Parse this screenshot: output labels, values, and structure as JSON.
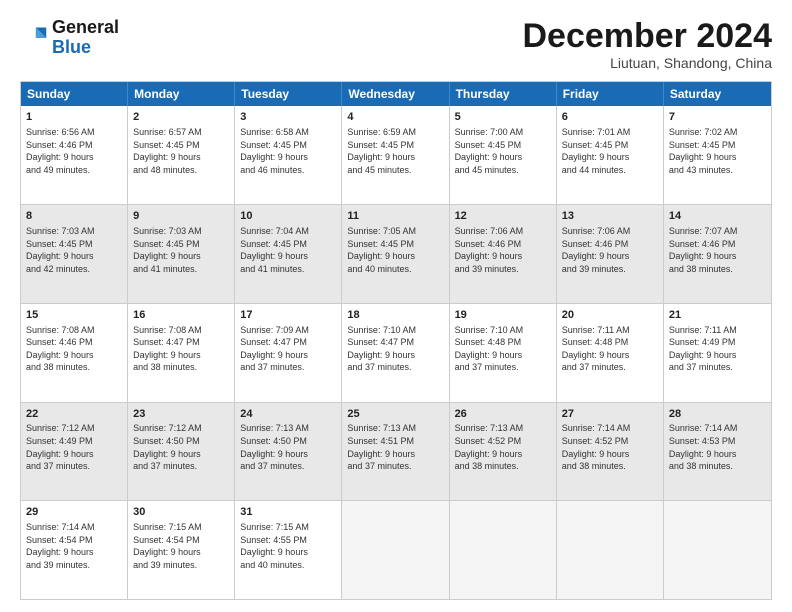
{
  "header": {
    "logo_line1": "General",
    "logo_line2": "Blue",
    "title": "December 2024",
    "subtitle": "Liutuan, Shandong, China"
  },
  "calendar": {
    "days_of_week": [
      "Sunday",
      "Monday",
      "Tuesday",
      "Wednesday",
      "Thursday",
      "Friday",
      "Saturday"
    ],
    "weeks": [
      [
        {
          "day": "1",
          "lines": [
            "Sunrise: 6:56 AM",
            "Sunset: 4:46 PM",
            "Daylight: 9 hours",
            "and 49 minutes."
          ],
          "shaded": false,
          "empty": false
        },
        {
          "day": "2",
          "lines": [
            "Sunrise: 6:57 AM",
            "Sunset: 4:45 PM",
            "Daylight: 9 hours",
            "and 48 minutes."
          ],
          "shaded": false,
          "empty": false
        },
        {
          "day": "3",
          "lines": [
            "Sunrise: 6:58 AM",
            "Sunset: 4:45 PM",
            "Daylight: 9 hours",
            "and 46 minutes."
          ],
          "shaded": false,
          "empty": false
        },
        {
          "day": "4",
          "lines": [
            "Sunrise: 6:59 AM",
            "Sunset: 4:45 PM",
            "Daylight: 9 hours",
            "and 45 minutes."
          ],
          "shaded": false,
          "empty": false
        },
        {
          "day": "5",
          "lines": [
            "Sunrise: 7:00 AM",
            "Sunset: 4:45 PM",
            "Daylight: 9 hours",
            "and 45 minutes."
          ],
          "shaded": false,
          "empty": false
        },
        {
          "day": "6",
          "lines": [
            "Sunrise: 7:01 AM",
            "Sunset: 4:45 PM",
            "Daylight: 9 hours",
            "and 44 minutes."
          ],
          "shaded": false,
          "empty": false
        },
        {
          "day": "7",
          "lines": [
            "Sunrise: 7:02 AM",
            "Sunset: 4:45 PM",
            "Daylight: 9 hours",
            "and 43 minutes."
          ],
          "shaded": false,
          "empty": false
        }
      ],
      [
        {
          "day": "8",
          "lines": [
            "Sunrise: 7:03 AM",
            "Sunset: 4:45 PM",
            "Daylight: 9 hours",
            "and 42 minutes."
          ],
          "shaded": true,
          "empty": false
        },
        {
          "day": "9",
          "lines": [
            "Sunrise: 7:03 AM",
            "Sunset: 4:45 PM",
            "Daylight: 9 hours",
            "and 41 minutes."
          ],
          "shaded": true,
          "empty": false
        },
        {
          "day": "10",
          "lines": [
            "Sunrise: 7:04 AM",
            "Sunset: 4:45 PM",
            "Daylight: 9 hours",
            "and 41 minutes."
          ],
          "shaded": true,
          "empty": false
        },
        {
          "day": "11",
          "lines": [
            "Sunrise: 7:05 AM",
            "Sunset: 4:45 PM",
            "Daylight: 9 hours",
            "and 40 minutes."
          ],
          "shaded": true,
          "empty": false
        },
        {
          "day": "12",
          "lines": [
            "Sunrise: 7:06 AM",
            "Sunset: 4:46 PM",
            "Daylight: 9 hours",
            "and 39 minutes."
          ],
          "shaded": true,
          "empty": false
        },
        {
          "day": "13",
          "lines": [
            "Sunrise: 7:06 AM",
            "Sunset: 4:46 PM",
            "Daylight: 9 hours",
            "and 39 minutes."
          ],
          "shaded": true,
          "empty": false
        },
        {
          "day": "14",
          "lines": [
            "Sunrise: 7:07 AM",
            "Sunset: 4:46 PM",
            "Daylight: 9 hours",
            "and 38 minutes."
          ],
          "shaded": true,
          "empty": false
        }
      ],
      [
        {
          "day": "15",
          "lines": [
            "Sunrise: 7:08 AM",
            "Sunset: 4:46 PM",
            "Daylight: 9 hours",
            "and 38 minutes."
          ],
          "shaded": false,
          "empty": false
        },
        {
          "day": "16",
          "lines": [
            "Sunrise: 7:08 AM",
            "Sunset: 4:47 PM",
            "Daylight: 9 hours",
            "and 38 minutes."
          ],
          "shaded": false,
          "empty": false
        },
        {
          "day": "17",
          "lines": [
            "Sunrise: 7:09 AM",
            "Sunset: 4:47 PM",
            "Daylight: 9 hours",
            "and 37 minutes."
          ],
          "shaded": false,
          "empty": false
        },
        {
          "day": "18",
          "lines": [
            "Sunrise: 7:10 AM",
            "Sunset: 4:47 PM",
            "Daylight: 9 hours",
            "and 37 minutes."
          ],
          "shaded": false,
          "empty": false
        },
        {
          "day": "19",
          "lines": [
            "Sunrise: 7:10 AM",
            "Sunset: 4:48 PM",
            "Daylight: 9 hours",
            "and 37 minutes."
          ],
          "shaded": false,
          "empty": false
        },
        {
          "day": "20",
          "lines": [
            "Sunrise: 7:11 AM",
            "Sunset: 4:48 PM",
            "Daylight: 9 hours",
            "and 37 minutes."
          ],
          "shaded": false,
          "empty": false
        },
        {
          "day": "21",
          "lines": [
            "Sunrise: 7:11 AM",
            "Sunset: 4:49 PM",
            "Daylight: 9 hours",
            "and 37 minutes."
          ],
          "shaded": false,
          "empty": false
        }
      ],
      [
        {
          "day": "22",
          "lines": [
            "Sunrise: 7:12 AM",
            "Sunset: 4:49 PM",
            "Daylight: 9 hours",
            "and 37 minutes."
          ],
          "shaded": true,
          "empty": false
        },
        {
          "day": "23",
          "lines": [
            "Sunrise: 7:12 AM",
            "Sunset: 4:50 PM",
            "Daylight: 9 hours",
            "and 37 minutes."
          ],
          "shaded": true,
          "empty": false
        },
        {
          "day": "24",
          "lines": [
            "Sunrise: 7:13 AM",
            "Sunset: 4:50 PM",
            "Daylight: 9 hours",
            "and 37 minutes."
          ],
          "shaded": true,
          "empty": false
        },
        {
          "day": "25",
          "lines": [
            "Sunrise: 7:13 AM",
            "Sunset: 4:51 PM",
            "Daylight: 9 hours",
            "and 37 minutes."
          ],
          "shaded": true,
          "empty": false
        },
        {
          "day": "26",
          "lines": [
            "Sunrise: 7:13 AM",
            "Sunset: 4:52 PM",
            "Daylight: 9 hours",
            "and 38 minutes."
          ],
          "shaded": true,
          "empty": false
        },
        {
          "day": "27",
          "lines": [
            "Sunrise: 7:14 AM",
            "Sunset: 4:52 PM",
            "Daylight: 9 hours",
            "and 38 minutes."
          ],
          "shaded": true,
          "empty": false
        },
        {
          "day": "28",
          "lines": [
            "Sunrise: 7:14 AM",
            "Sunset: 4:53 PM",
            "Daylight: 9 hours",
            "and 38 minutes."
          ],
          "shaded": true,
          "empty": false
        }
      ],
      [
        {
          "day": "29",
          "lines": [
            "Sunrise: 7:14 AM",
            "Sunset: 4:54 PM",
            "Daylight: 9 hours",
            "and 39 minutes."
          ],
          "shaded": false,
          "empty": false
        },
        {
          "day": "30",
          "lines": [
            "Sunrise: 7:15 AM",
            "Sunset: 4:54 PM",
            "Daylight: 9 hours",
            "and 39 minutes."
          ],
          "shaded": false,
          "empty": false
        },
        {
          "day": "31",
          "lines": [
            "Sunrise: 7:15 AM",
            "Sunset: 4:55 PM",
            "Daylight: 9 hours",
            "and 40 minutes."
          ],
          "shaded": false,
          "empty": false
        },
        {
          "day": "",
          "lines": [],
          "shaded": false,
          "empty": true
        },
        {
          "day": "",
          "lines": [],
          "shaded": false,
          "empty": true
        },
        {
          "day": "",
          "lines": [],
          "shaded": false,
          "empty": true
        },
        {
          "day": "",
          "lines": [],
          "shaded": false,
          "empty": true
        }
      ]
    ]
  }
}
